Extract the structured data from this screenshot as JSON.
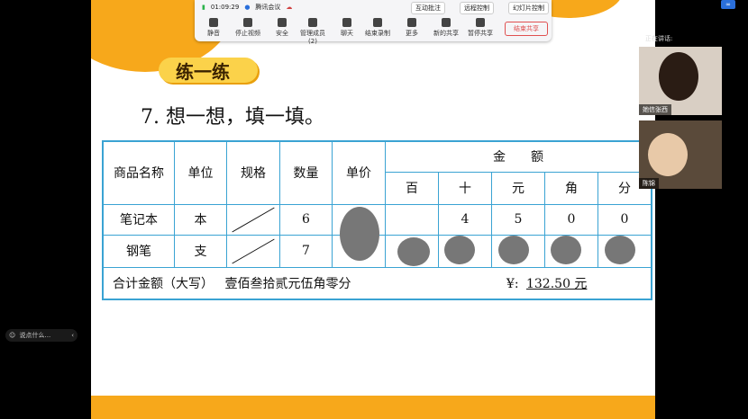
{
  "meeting": {
    "time": "01:09:29",
    "app_name": "腾讯会议",
    "controls": [
      "静音",
      "停止视频",
      "安全",
      "管理成员(2)",
      "聊天",
      "结束录制",
      "更多",
      "新的共享",
      "暂停共享"
    ],
    "top_buttons": [
      "互动批注",
      "远程控制",
      "幻灯片控制"
    ],
    "end_share": "结束共享",
    "speaking_label": "正在讲话:",
    "participants": [
      {
        "name": "她信张西"
      },
      {
        "name": "陈锦"
      }
    ],
    "chat_placeholder": "说点什么..."
  },
  "slide": {
    "badge": "练一练",
    "question": "7. 想一想，填一填。",
    "headers": [
      "商品名称",
      "单位",
      "规格",
      "数量",
      "单价",
      "金　　额"
    ],
    "money_units": [
      "百",
      "十",
      "元",
      "角",
      "分"
    ],
    "rows": [
      {
        "name": "笔记本",
        "unit": "本",
        "qty": "6",
        "money": [
          "",
          "4",
          "5",
          "0",
          "0"
        ]
      },
      {
        "name": "钢笔",
        "unit": "支",
        "qty": "7",
        "money": [
          "",
          "",
          "",
          "",
          ""
        ]
      }
    ],
    "sum_label": "合计金额（大写）",
    "sum_text": "壹佰叁拾贰元伍角零分",
    "sum_currency": "¥:",
    "sum_amount": "132.50 元"
  }
}
